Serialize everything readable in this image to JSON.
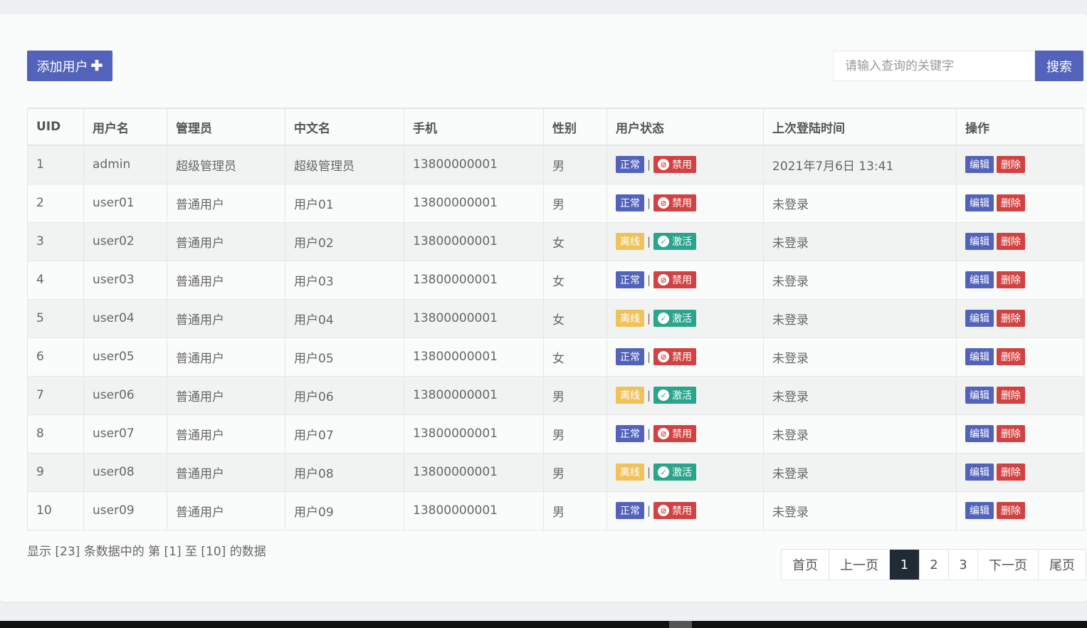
{
  "toolbar": {
    "add_label": "添加用户",
    "search_placeholder": "请输入查询的关键字",
    "search_label": "搜索"
  },
  "columns": [
    "UID",
    "用户名",
    "管理员",
    "中文名",
    "手机",
    "性别",
    "用户状态",
    "上次登陆时间",
    "操作"
  ],
  "rows": [
    {
      "uid": "1",
      "username": "admin",
      "role": "超级管理员",
      "cname": "超级管理员",
      "phone": "13800000001",
      "gender": "男",
      "status": "正常",
      "toggle": "禁用",
      "last_login": "2021年7月6日 13:41"
    },
    {
      "uid": "2",
      "username": "user01",
      "role": "普通用户",
      "cname": "用户01",
      "phone": "13800000001",
      "gender": "男",
      "status": "正常",
      "toggle": "禁用",
      "last_login": "未登录"
    },
    {
      "uid": "3",
      "username": "user02",
      "role": "普通用户",
      "cname": "用户02",
      "phone": "13800000001",
      "gender": "女",
      "status": "离线",
      "toggle": "激活",
      "last_login": "未登录"
    },
    {
      "uid": "4",
      "username": "user03",
      "role": "普通用户",
      "cname": "用户03",
      "phone": "13800000001",
      "gender": "女",
      "status": "正常",
      "toggle": "禁用",
      "last_login": "未登录"
    },
    {
      "uid": "5",
      "username": "user04",
      "role": "普通用户",
      "cname": "用户04",
      "phone": "13800000001",
      "gender": "女",
      "status": "离线",
      "toggle": "激活",
      "last_login": "未登录"
    },
    {
      "uid": "6",
      "username": "user05",
      "role": "普通用户",
      "cname": "用户05",
      "phone": "13800000001",
      "gender": "女",
      "status": "正常",
      "toggle": "禁用",
      "last_login": "未登录"
    },
    {
      "uid": "7",
      "username": "user06",
      "role": "普通用户",
      "cname": "用户06",
      "phone": "13800000001",
      "gender": "男",
      "status": "离线",
      "toggle": "激活",
      "last_login": "未登录"
    },
    {
      "uid": "8",
      "username": "user07",
      "role": "普通用户",
      "cname": "用户07",
      "phone": "13800000001",
      "gender": "男",
      "status": "正常",
      "toggle": "禁用",
      "last_login": "未登录"
    },
    {
      "uid": "9",
      "username": "user08",
      "role": "普通用户",
      "cname": "用户08",
      "phone": "13800000001",
      "gender": "男",
      "status": "离线",
      "toggle": "激活",
      "last_login": "未登录"
    },
    {
      "uid": "10",
      "username": "user09",
      "role": "普通用户",
      "cname": "用户09",
      "phone": "13800000001",
      "gender": "男",
      "status": "正常",
      "toggle": "禁用",
      "last_login": "未登录"
    }
  ],
  "actions": {
    "edit_label": "编辑",
    "delete_label": "删除"
  },
  "footer": {
    "info": "显示 [23] 条数据中的 第 [1] 至 [10] 的数据"
  },
  "pagination": {
    "first": "首页",
    "prev": "上一页",
    "pages": [
      "1",
      "2",
      "3"
    ],
    "current": "1",
    "next": "下一页",
    "last": "尾页"
  },
  "colors": {
    "primary": "#5363bb",
    "danger": "#d24242",
    "warning": "#f0c35a",
    "success": "#2aa58c",
    "pager_active": "#212b36"
  },
  "icons": {
    "add": "plus-icon",
    "ban": "ban-icon",
    "activate": "check-circle-icon"
  }
}
